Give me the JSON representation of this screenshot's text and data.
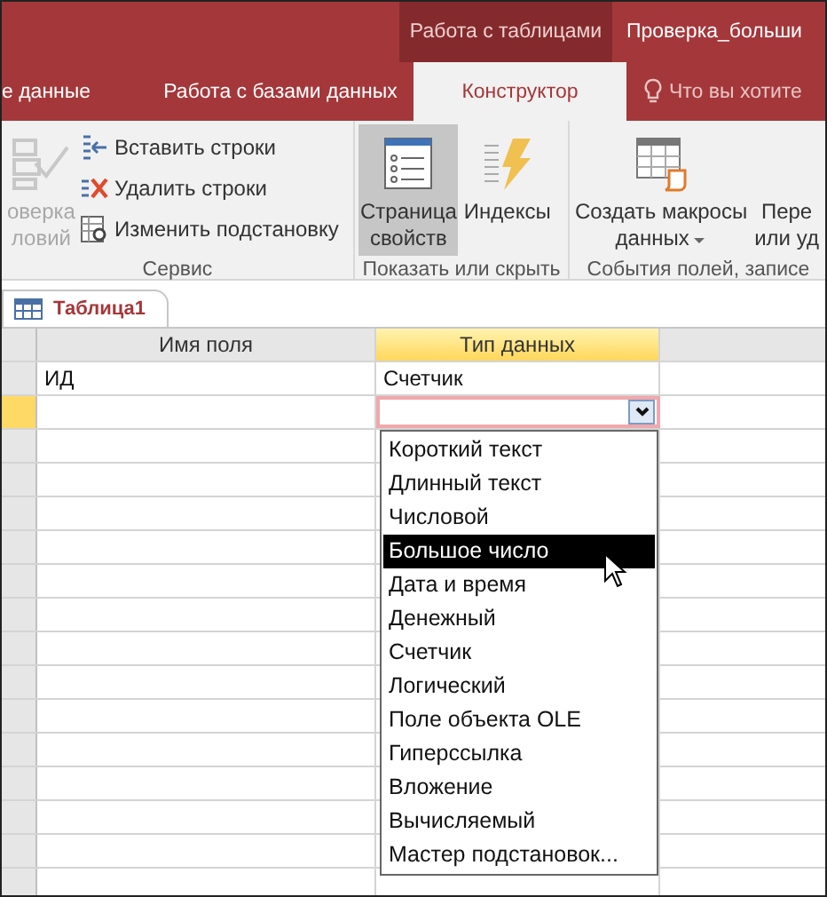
{
  "title_bar": {
    "context_tab": "Работа с таблицами",
    "document_title": "Проверка_больши"
  },
  "tabs": [
    {
      "label": "е данные",
      "selected": false
    },
    {
      "label": "Работа с базами данных",
      "selected": false
    },
    {
      "label": "Конструктор",
      "selected": true
    }
  ],
  "tell_me": {
    "placeholder": "Что вы хотите"
  },
  "ribbon": {
    "groups": [
      {
        "label": "Сервис",
        "items": [
          {
            "kind": "large",
            "lines": [
              "оверка",
              "ловий"
            ],
            "disabled": true,
            "selected": false
          },
          {
            "kind": "small",
            "lines": [
              "Вставить строки"
            ],
            "disabled": false,
            "selected": false
          },
          {
            "kind": "small",
            "lines": [
              "Удалить строки"
            ],
            "disabled": false,
            "selected": false
          },
          {
            "kind": "small",
            "lines": [
              "Изменить подстановку"
            ],
            "disabled": false,
            "selected": false
          }
        ]
      },
      {
        "label": "Показать или скрыть",
        "items": [
          {
            "kind": "large",
            "lines": [
              "Страница",
              "свойств"
            ],
            "disabled": false,
            "selected": true
          },
          {
            "kind": "large",
            "lines": [
              "Индексы"
            ],
            "disabled": false,
            "selected": false
          }
        ]
      },
      {
        "label": "События полей, записе",
        "items": [
          {
            "kind": "large",
            "lines": [
              "Создать макросы",
              "данных"
            ],
            "disabled": false,
            "selected": false,
            "dropdown": true
          },
          {
            "kind": "large",
            "lines": [
              "Пере",
              "или уд"
            ],
            "disabled": false,
            "selected": false
          }
        ]
      }
    ]
  },
  "document_tab": {
    "label": "Таблица1"
  },
  "grid": {
    "columns": [
      {
        "label": "Имя поля",
        "selected": false
      },
      {
        "label": "Тип данных",
        "selected": true
      }
    ],
    "rows": [
      {
        "field_name": "ИД",
        "data_type": "Счетчик",
        "current": false
      },
      {
        "field_name": "",
        "data_type": "",
        "current": true
      }
    ]
  },
  "dropdown": {
    "items": [
      {
        "label": "Короткий текст",
        "selected": false
      },
      {
        "label": "Длинный текст",
        "selected": false
      },
      {
        "label": "Числовой",
        "selected": false
      },
      {
        "label": "Большое число",
        "selected": true
      },
      {
        "label": "Дата и время",
        "selected": false
      },
      {
        "label": "Денежный",
        "selected": false
      },
      {
        "label": "Счетчик",
        "selected": false
      },
      {
        "label": "Логический",
        "selected": false
      },
      {
        "label": "Поле объекта OLE",
        "selected": false
      },
      {
        "label": "Гиперссылка",
        "selected": false
      },
      {
        "label": "Вложение",
        "selected": false
      },
      {
        "label": "Вычисляемый",
        "selected": false
      },
      {
        "label": "Мастер подстановок...",
        "selected": false
      }
    ]
  }
}
